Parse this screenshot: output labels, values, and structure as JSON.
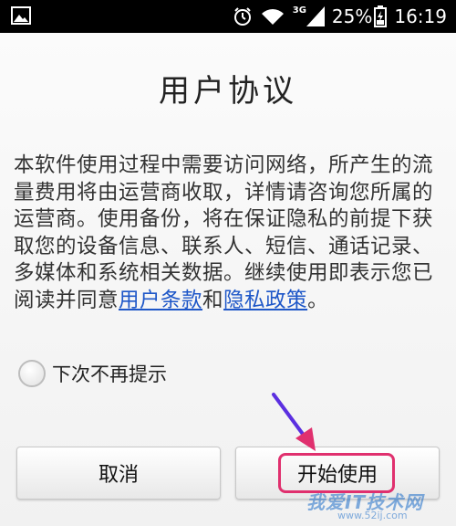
{
  "status_bar": {
    "network_label": "3G",
    "battery_percent": "25%",
    "time": "16:19",
    "icons": [
      "gallery-icon",
      "alarm-icon",
      "wifi-icon",
      "signal-icon",
      "battery-icon"
    ]
  },
  "dialog": {
    "title": "用户协议",
    "body_before_link": "本软件使用过程中需要访问网络，所产生的流量费用将由运营商收取，详情请咨询您所属的运营商。使用备份，将在保证隐私的前提下获取您的设备信息、联系人、短信、通话记录、多媒体和系统相关数据。继续使用即表示您已阅读并同意",
    "terms_link": "用户条款",
    "and_text": "和",
    "privacy_link": "隐私政策",
    "period": "。",
    "checkbox_label": "下次不再提示",
    "checkbox_checked": false,
    "cancel_label": "取消",
    "start_label": "开始使用"
  },
  "annotation": {
    "highlight_color": "#e0306e",
    "arrow_color": "#5b2fe0"
  },
  "watermark": {
    "text": "我爱IT技术网",
    "sub": "www.52ij.com"
  }
}
